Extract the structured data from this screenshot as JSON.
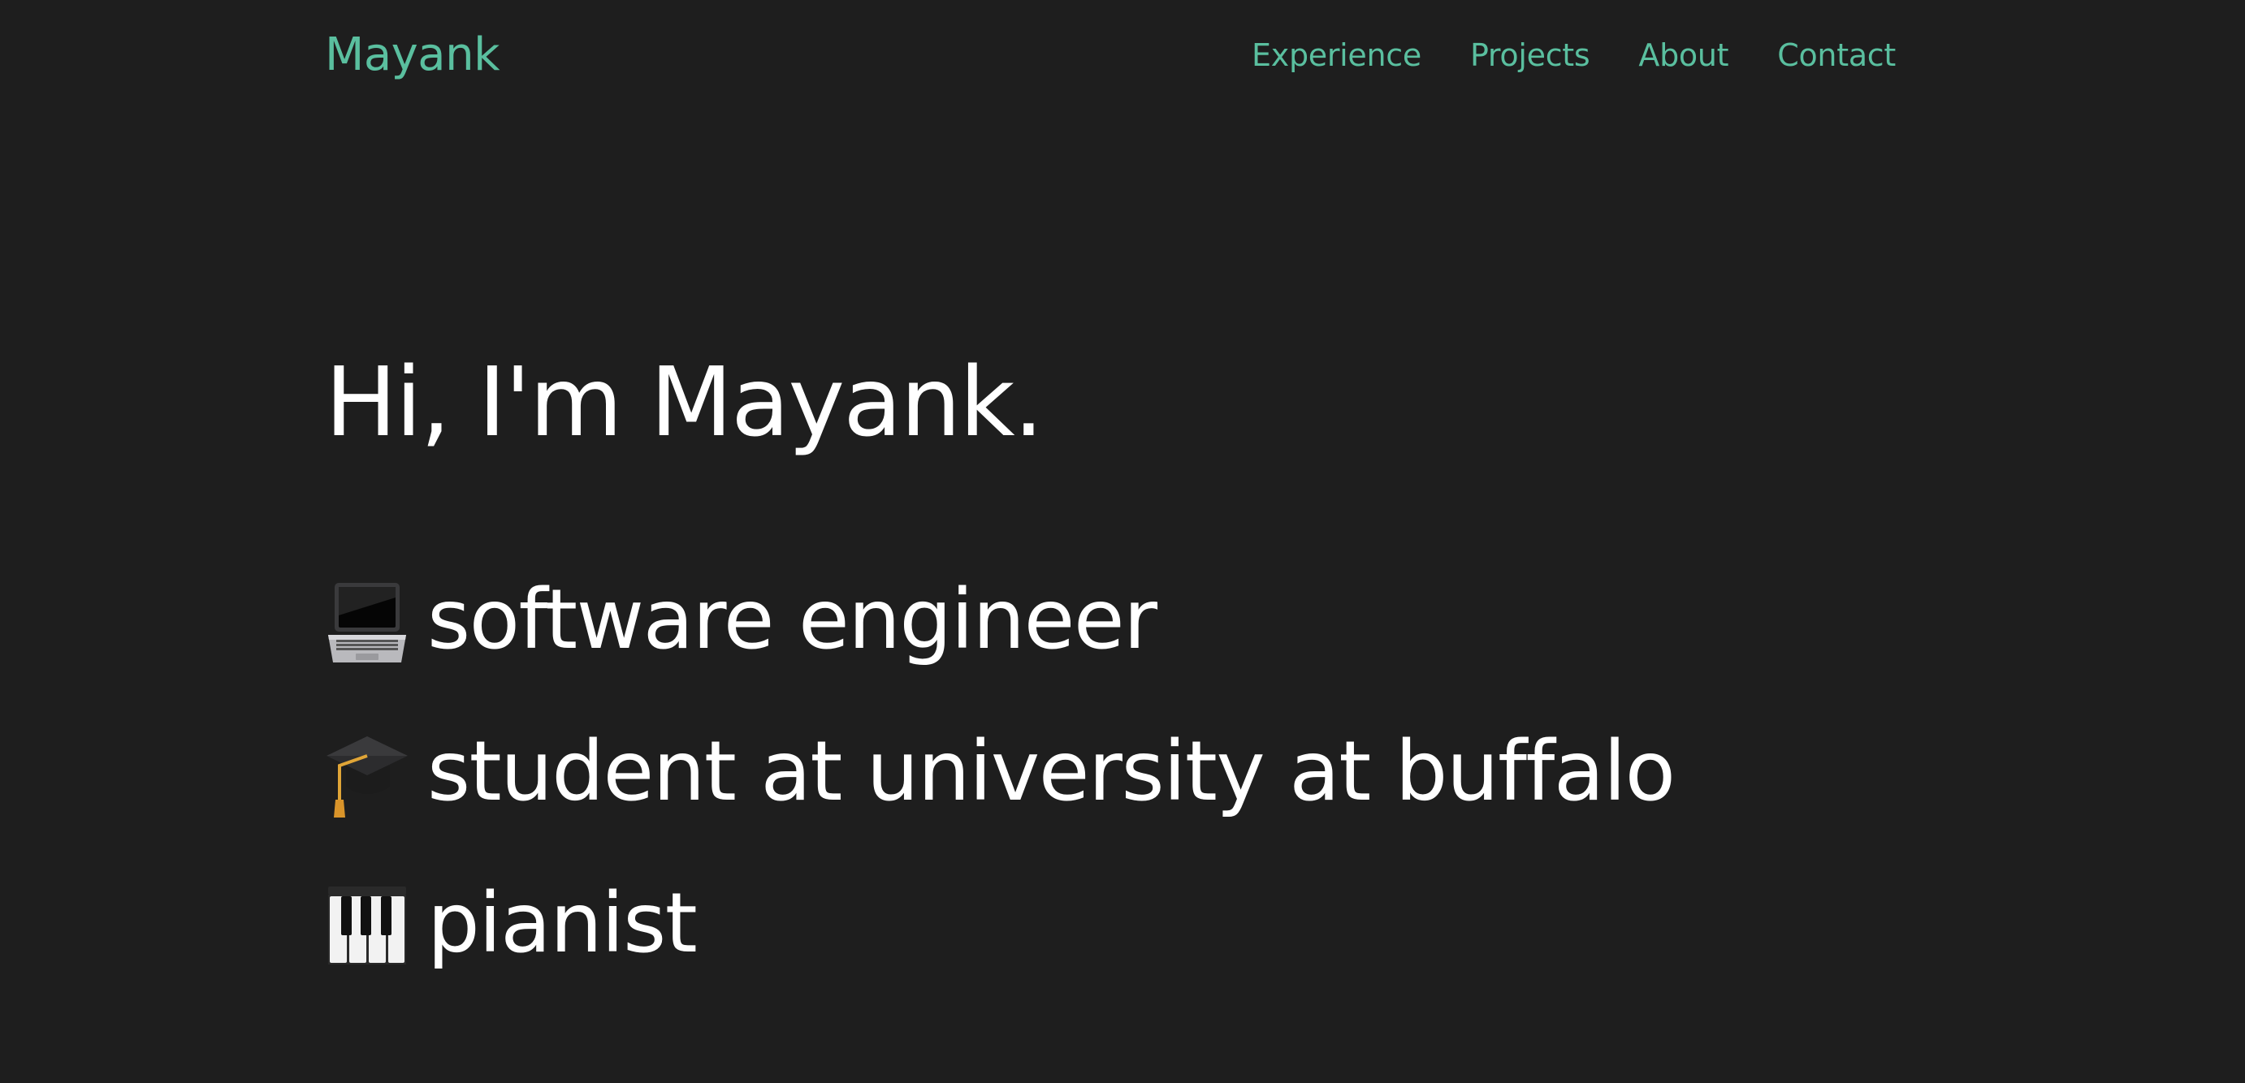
{
  "header": {
    "brand": "Mayank",
    "nav": [
      {
        "label": "Experience"
      },
      {
        "label": "Projects"
      },
      {
        "label": "About"
      },
      {
        "label": "Contact"
      }
    ]
  },
  "hero": {
    "title": "Hi, I'm Mayank.",
    "roles": [
      {
        "icon": "laptop-icon",
        "text": "software engineer"
      },
      {
        "icon": "graduation-cap-icon",
        "text": "student at university at buffalo"
      },
      {
        "icon": "piano-keys-icon",
        "text": "pianist"
      }
    ]
  },
  "colors": {
    "background": "#1e1e1e",
    "accent": "#5abf9f",
    "text": "#ffffff"
  }
}
